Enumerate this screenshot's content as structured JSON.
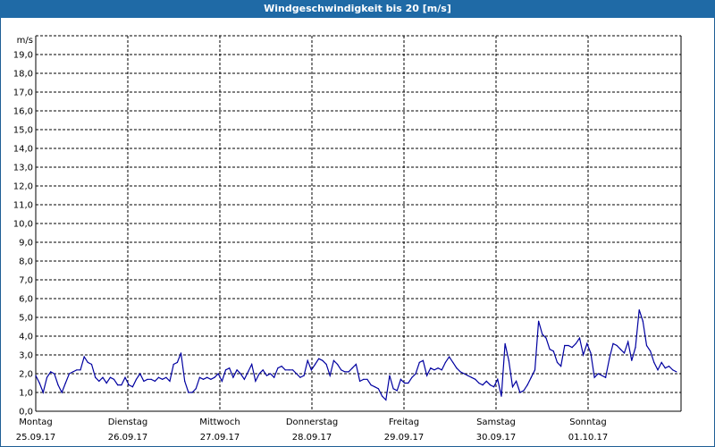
{
  "window": {
    "title": "Windgeschwindigkeit bis 20 [m/s]"
  },
  "chart_data": {
    "type": "line",
    "title": "Windgeschwindigkeit bis 20 [m/s]",
    "ylabel": "m/s",
    "xlabel": "",
    "ylim": [
      0,
      20
    ],
    "yticks": [
      "0,0",
      "1,0",
      "2,0",
      "3,0",
      "4,0",
      "5,0",
      "6,0",
      "7,0",
      "8,0",
      "9,0",
      "10,0",
      "11,0",
      "12,0",
      "13,0",
      "14,0",
      "15,0",
      "16,0",
      "17,0",
      "18,0",
      "19,0"
    ],
    "grid": true,
    "line_color": "#0000a0",
    "days": [
      {
        "weekday": "Montag",
        "date": "25.09.17"
      },
      {
        "weekday": "Dienstag",
        "date": "26.09.17"
      },
      {
        "weekday": "Mittwoch",
        "date": "27.09.17"
      },
      {
        "weekday": "Donnerstag",
        "date": "28.09.17"
      },
      {
        "weekday": "Freitag",
        "date": "29.09.17"
      },
      {
        "weekday": "Samstag",
        "date": "30.09.17"
      },
      {
        "weekday": "Sonntag",
        "date": "01.10.17"
      }
    ],
    "series": [
      {
        "values": [
          1.9,
          1.5,
          1.0,
          1.8,
          2.1,
          2.0,
          1.4,
          1.0,
          1.5,
          2.0,
          2.1,
          2.2,
          2.2,
          2.9,
          2.6,
          2.5,
          1.8,
          1.6,
          1.8,
          1.5,
          1.8,
          1.7,
          1.4,
          1.4,
          1.8,
          1.4,
          1.3,
          1.7,
          2.0,
          1.6,
          1.7,
          1.7,
          1.6,
          1.8,
          1.7,
          1.8,
          1.6,
          2.5,
          2.6,
          3.1,
          1.6,
          1.0,
          1.0,
          1.2,
          1.8,
          1.7,
          1.8,
          1.7,
          1.8,
          2.0,
          1.6,
          2.2,
          2.3,
          1.8,
          2.2,
          2.0,
          1.7,
          2.1,
          2.5,
          1.6,
          2.0,
          2.2,
          1.9,
          2.0,
          1.8,
          2.3,
          2.4,
          2.2,
          2.2,
          2.2,
          2.0,
          1.8,
          1.9,
          2.7,
          2.2,
          2.5,
          2.8,
          2.7,
          2.5,
          1.9,
          2.7,
          2.5,
          2.2,
          2.1,
          2.1,
          2.3,
          2.5,
          1.6,
          1.7,
          1.7,
          1.4,
          1.3,
          1.2,
          0.8,
          0.6,
          1.9,
          1.2,
          1.1,
          1.7,
          1.5,
          1.5,
          1.8,
          2.0,
          2.6,
          2.7,
          1.9,
          2.3,
          2.2,
          2.3,
          2.2,
          2.6,
          2.9,
          2.6,
          2.3,
          2.1,
          2.0,
          1.9,
          1.8,
          1.7,
          1.5,
          1.4,
          1.6,
          1.4,
          1.3,
          1.7,
          0.8,
          3.6,
          2.7,
          1.3,
          1.6,
          1.0,
          1.1,
          1.4,
          1.8,
          2.2,
          4.8,
          4.1,
          3.9,
          3.3,
          3.2,
          2.6,
          2.4,
          3.5,
          3.5,
          3.4,
          3.6,
          3.9,
          3.0,
          3.6,
          3.1,
          1.8,
          2.0,
          1.9,
          1.8,
          2.8,
          3.6,
          3.5,
          3.3,
          3.1,
          3.7,
          2.7,
          3.4,
          5.4,
          4.8,
          3.5,
          3.2,
          2.6,
          2.2,
          2.6,
          2.3,
          2.4,
          2.2,
          2.1
        ]
      }
    ]
  }
}
